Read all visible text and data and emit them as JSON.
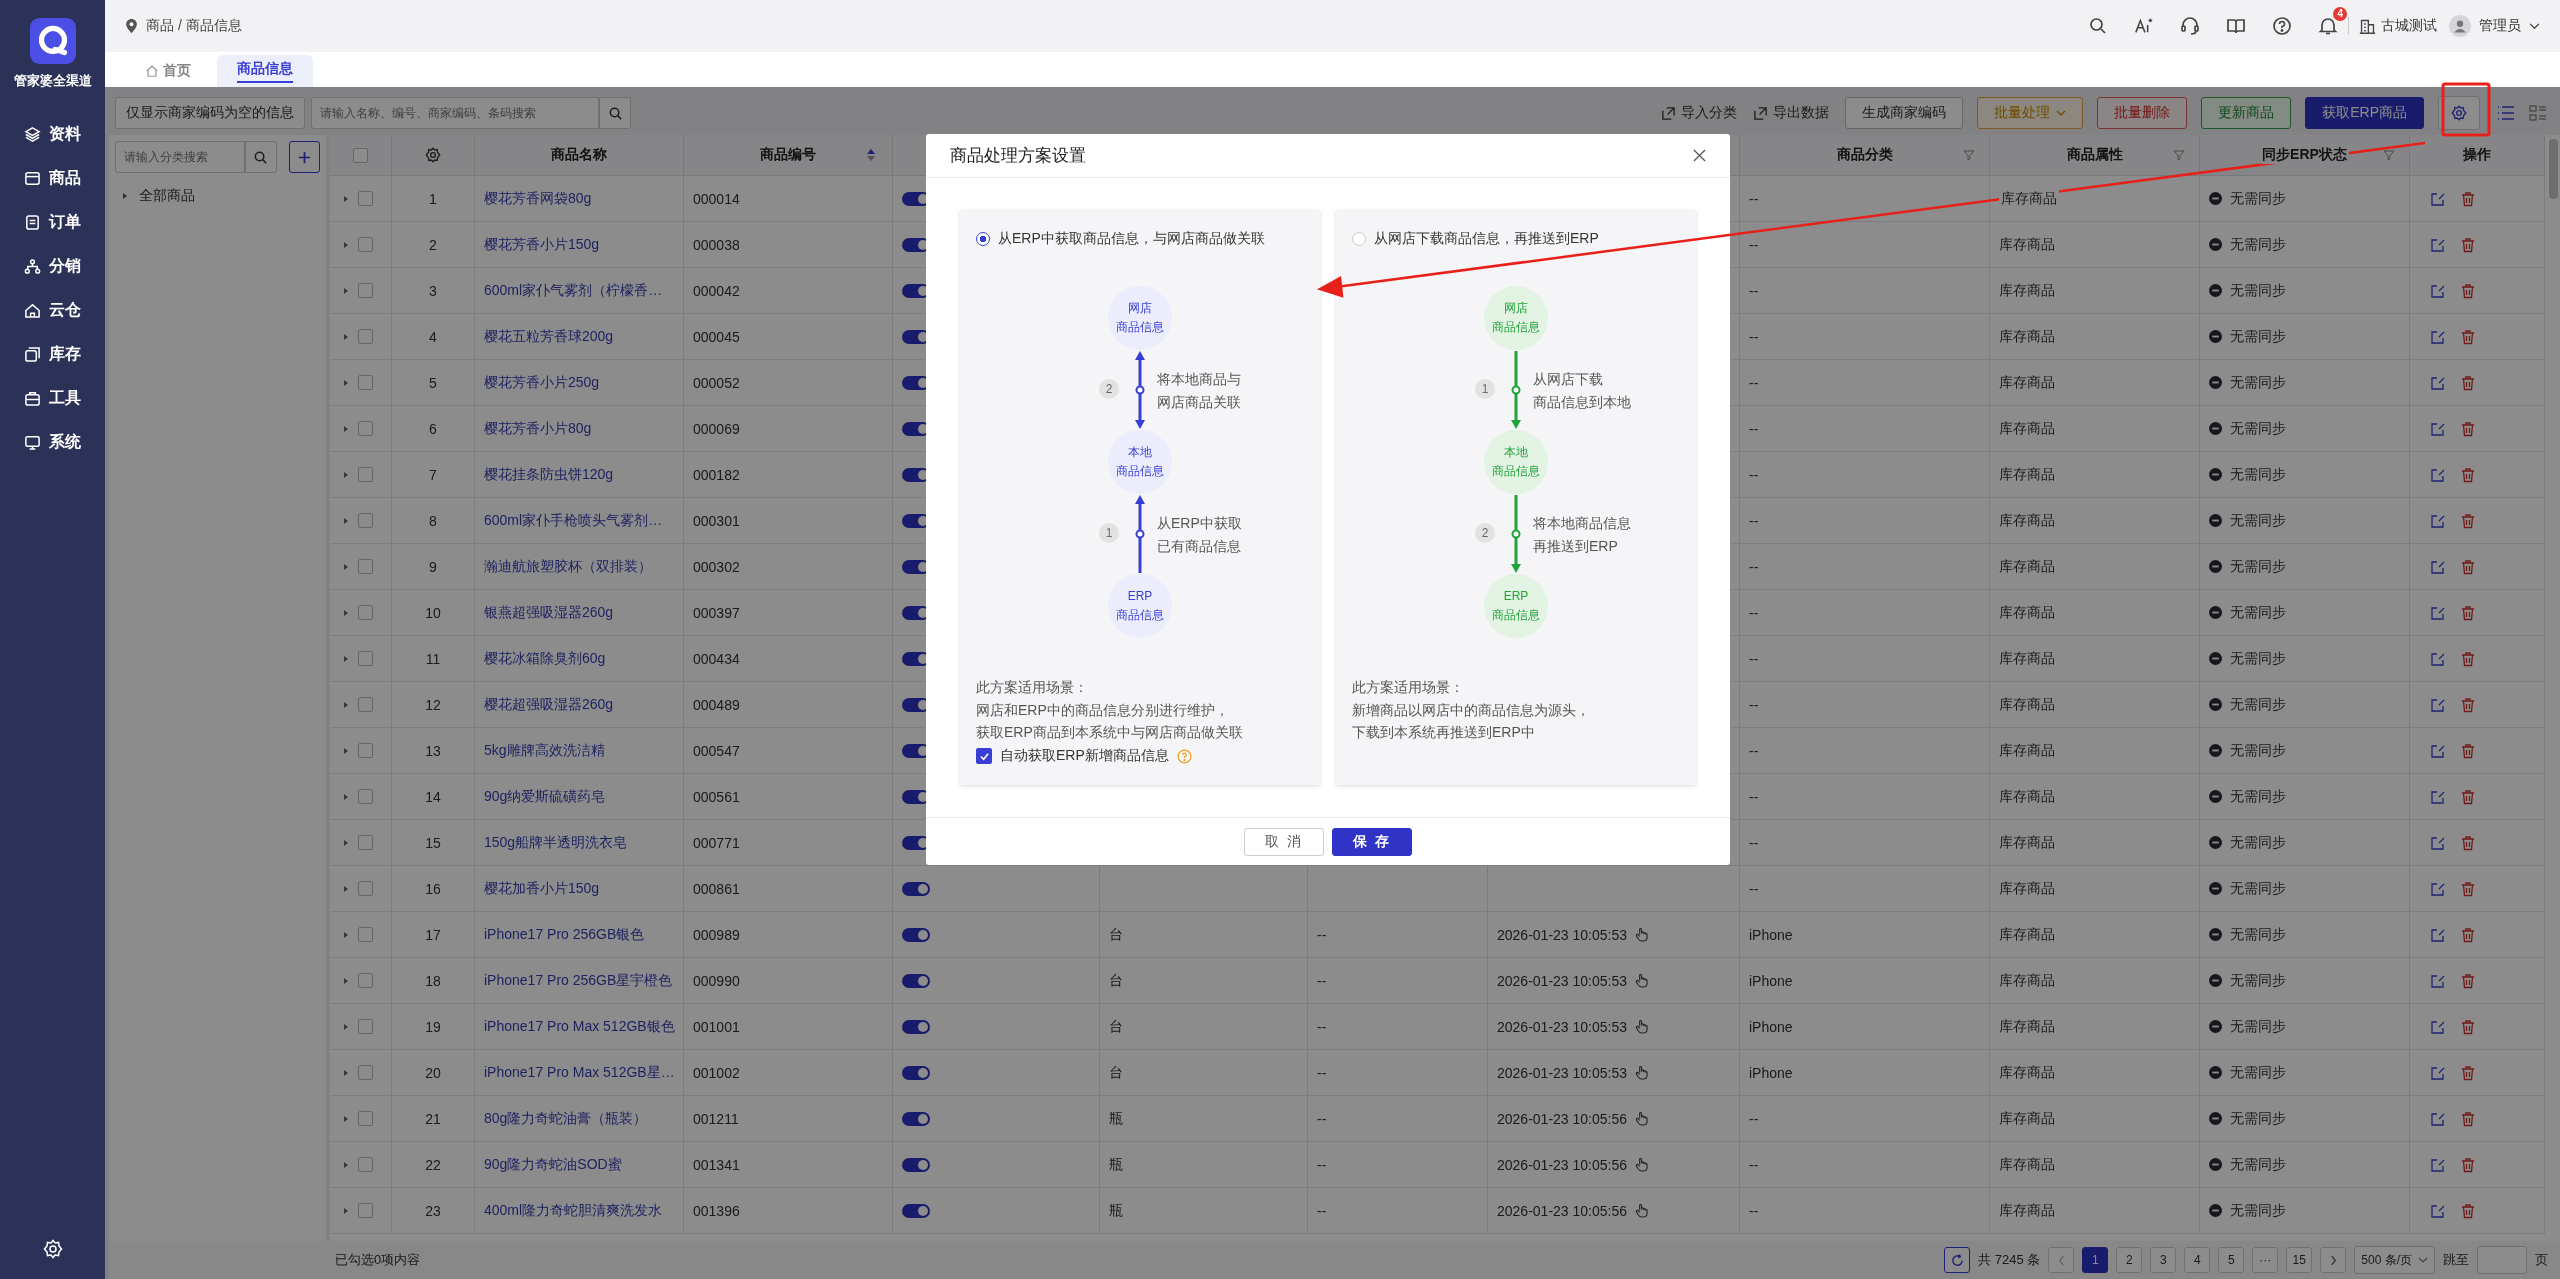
{
  "sidebar": {
    "brand": "管家婆全渠道",
    "items": [
      {
        "label": "资料"
      },
      {
        "label": "商品"
      },
      {
        "label": "订单"
      },
      {
        "label": "分销"
      },
      {
        "label": "云仓"
      },
      {
        "label": "库存"
      },
      {
        "label": "工具"
      },
      {
        "label": "系统"
      }
    ]
  },
  "header": {
    "breadcrumb": "商品 / 商品信息",
    "notification_count": "4",
    "company": "古城测试",
    "user": "管理员"
  },
  "tabs": [
    {
      "label": "首页",
      "selected": false
    },
    {
      "label": "商品信息",
      "selected": true
    }
  ],
  "toolbar": {
    "filter_button": "仅显示商家编码为空的信息",
    "search_placeholder": "请输入名称、编号、商家编码、条码搜索",
    "links": [
      "导入分类",
      "导出数据"
    ],
    "buttons": [
      {
        "label": "生成商家编码",
        "kind": "default"
      },
      {
        "label": "批量处理",
        "kind": "warning"
      },
      {
        "label": "批量删除",
        "kind": "danger"
      },
      {
        "label": "更新商品",
        "kind": "success"
      },
      {
        "label": "获取ERP商品",
        "kind": "primary"
      }
    ]
  },
  "category_panel": {
    "search_placeholder": "请输入分类搜索",
    "tree": [
      {
        "label": "全部商品",
        "expanded": false
      }
    ]
  },
  "table": {
    "header_checked": false,
    "columns": [
      {
        "label": "商品名称"
      },
      {
        "label": "商品编号",
        "sortable": true
      },
      {
        "label": "商品分类",
        "filterable": true
      },
      {
        "label": "商品属性",
        "filterable": true
      },
      {
        "label": "同步ERP状态",
        "filterable": true
      },
      {
        "label": "操作"
      }
    ],
    "rows": [
      {
        "index": "1",
        "name": "樱花芳香网袋80g",
        "code": "000014",
        "enabled": true,
        "checked": false,
        "category": "--",
        "attribute": "库存商品",
        "sync": "无需同步"
      },
      {
        "index": "2",
        "name": "樱花芳香小片150g",
        "code": "000038",
        "enabled": true,
        "checked": false,
        "category": "--",
        "attribute": "库存商品",
        "sync": "无需同步"
      },
      {
        "index": "3",
        "name": "600ml家仆气雾剂（柠檬香…",
        "code": "000042",
        "enabled": true,
        "checked": false,
        "category": "--",
        "attribute": "库存商品",
        "sync": "无需同步"
      },
      {
        "index": "4",
        "name": "樱花五粒芳香球200g",
        "code": "000045",
        "enabled": true,
        "checked": false,
        "category": "--",
        "attribute": "库存商品",
        "sync": "无需同步"
      },
      {
        "index": "5",
        "name": "樱花芳香小片250g",
        "code": "000052",
        "enabled": true,
        "checked": false,
        "category": "--",
        "attribute": "库存商品",
        "sync": "无需同步"
      },
      {
        "index": "6",
        "name": "樱花芳香小片80g",
        "code": "000069",
        "enabled": true,
        "checked": false,
        "category": "--",
        "attribute": "库存商品",
        "sync": "无需同步"
      },
      {
        "index": "7",
        "name": "樱花挂条防虫饼120g",
        "code": "000182",
        "enabled": true,
        "checked": false,
        "category": "--",
        "attribute": "库存商品",
        "sync": "无需同步"
      },
      {
        "index": "8",
        "name": "600ml家仆手枪喷头气雾剂…",
        "code": "000301",
        "enabled": true,
        "checked": false,
        "category": "--",
        "attribute": "库存商品",
        "sync": "无需同步"
      },
      {
        "index": "9",
        "name": "瀚迪航旅塑胶杯（双排装）",
        "code": "000302",
        "enabled": true,
        "checked": false,
        "category": "--",
        "attribute": "库存商品",
        "sync": "无需同步"
      },
      {
        "index": "10",
        "name": "银燕超强吸湿器260g",
        "code": "000397",
        "enabled": true,
        "checked": false,
        "category": "--",
        "attribute": "库存商品",
        "sync": "无需同步"
      },
      {
        "index": "11",
        "name": "樱花冰箱除臭剂60g",
        "code": "000434",
        "enabled": true,
        "checked": false,
        "category": "--",
        "attribute": "库存商品",
        "sync": "无需同步"
      },
      {
        "index": "12",
        "name": "樱花超强吸湿器260g",
        "code": "000489",
        "enabled": true,
        "checked": false,
        "category": "--",
        "attribute": "库存商品",
        "sync": "无需同步"
      },
      {
        "index": "13",
        "name": "5kg雕牌高效洗洁精",
        "code": "000547",
        "enabled": true,
        "checked": false,
        "category": "--",
        "attribute": "库存商品",
        "sync": "无需同步"
      },
      {
        "index": "14",
        "name": "90g纳爱斯硫磺药皂",
        "code": "000561",
        "enabled": true,
        "checked": false,
        "category": "--",
        "attribute": "库存商品",
        "sync": "无需同步"
      },
      {
        "index": "15",
        "name": "150g船牌半透明洗衣皂",
        "code": "000771",
        "enabled": true,
        "checked": false,
        "category": "--",
        "attribute": "库存商品",
        "sync": "无需同步"
      },
      {
        "index": "16",
        "name": "樱花加香小片150g",
        "code": "000861",
        "enabled": true,
        "checked": false,
        "category": "--",
        "attribute": "库存商品",
        "sync": "无需同步"
      },
      {
        "index": "17",
        "name": "iPhone17 Pro 256GB银色",
        "code": "000989",
        "enabled": true,
        "checked": false,
        "unit": "台",
        "column_7": "--",
        "time": "2026-01-23 10:05:53",
        "category": "iPhone",
        "attribute": "库存商品",
        "sync": "无需同步"
      },
      {
        "index": "18",
        "name": "iPhone17 Pro 256GB星宇橙色",
        "code": "000990",
        "enabled": true,
        "checked": false,
        "unit": "台",
        "column_7": "--",
        "time": "2026-01-23 10:05:53",
        "category": "iPhone",
        "attribute": "库存商品",
        "sync": "无需同步"
      },
      {
        "index": "19",
        "name": "iPhone17 Pro Max 512GB银色",
        "code": "001001",
        "enabled": true,
        "checked": false,
        "unit": "台",
        "column_7": "--",
        "time": "2026-01-23 10:05:53",
        "category": "iPhone",
        "attribute": "库存商品",
        "sync": "无需同步"
      },
      {
        "index": "20",
        "name": "iPhone17 Pro Max 512GB星…",
        "code": "001002",
        "enabled": true,
        "checked": false,
        "unit": "台",
        "column_7": "--",
        "time": "2026-01-23 10:05:53",
        "category": "iPhone",
        "attribute": "库存商品",
        "sync": "无需同步"
      },
      {
        "index": "21",
        "name": "80g隆力奇蛇油膏（瓶装）",
        "code": "001211",
        "enabled": true,
        "checked": false,
        "unit": "瓶",
        "column_7": "--",
        "time": "2026-01-23 10:05:56",
        "category": "--",
        "attribute": "库存商品",
        "sync": "无需同步"
      },
      {
        "index": "22",
        "name": "90g隆力奇蛇油SOD蜜",
        "code": "001341",
        "enabled": true,
        "checked": false,
        "unit": "瓶",
        "column_7": "--",
        "time": "2026-01-23 10:05:56",
        "category": "--",
        "attribute": "库存商品",
        "sync": "无需同步"
      },
      {
        "index": "23",
        "name": "400ml隆力奇蛇胆清爽洗发水",
        "code": "001396",
        "enabled": true,
        "checked": false,
        "unit": "瓶",
        "column_7": "--",
        "time": "2026-01-23 10:05:56",
        "category": "--",
        "attribute": "库存商品",
        "sync": "无需同步"
      }
    ]
  },
  "footer": {
    "selection": "已勾选0项内容",
    "total": "共 7245 条",
    "pages": [
      {
        "label": "1",
        "selected": true
      },
      {
        "label": "2",
        "selected": false
      },
      {
        "label": "3",
        "selected": false
      },
      {
        "label": "4",
        "selected": false
      },
      {
        "label": "5",
        "selected": false
      },
      {
        "label": "···",
        "selected": false
      },
      {
        "label": "15",
        "selected": false
      }
    ],
    "page_size": "500 条/页",
    "jump_label": "跳至",
    "page_unit": "页"
  },
  "dialog": {
    "title": "商品处理方案设置",
    "cancel": "取 消",
    "save": "保 存",
    "options": [
      {
        "label": "从ERP中获取商品信息，与网店商品做关联",
        "selected": true,
        "color": "#3a3fd4",
        "nodes": [
          [
            "网店",
            "商品信息"
          ],
          [
            "本地",
            "商品信息"
          ],
          [
            "ERP",
            "商品信息"
          ]
        ],
        "steps": [
          {
            "number": "2",
            "lines": [
              "将本地商品与",
              "网店商品关联"
            ],
            "kind": "both"
          },
          {
            "number": "1",
            "lines": [
              "从ERP中获取",
              "已有商品信息"
            ],
            "kind": "up"
          }
        ],
        "scenario": [
          "此方案适用场景：",
          "网店和ERP中的商品信息分别进行维护，",
          "获取ERP商品到本系统中与网店商品做关联"
        ],
        "auto_fetch": {
          "label": "自动获取ERP新增商品信息",
          "checked": true
        }
      },
      {
        "label": "从网店下载商品信息，再推送到ERP",
        "selected": false,
        "color": "#22a33a",
        "nodes": [
          [
            "网店",
            "商品信息"
          ],
          [
            "本地",
            "商品信息"
          ],
          [
            "ERP",
            "商品信息"
          ]
        ],
        "steps": [
          {
            "number": "1",
            "lines": [
              "从网店下载",
              "商品信息到本地"
            ],
            "kind": "down"
          },
          {
            "number": "2",
            "lines": [
              "将本地商品信息",
              "再推送到ERP"
            ],
            "kind": "down"
          }
        ],
        "scenario": [
          "此方案适用场景：",
          "新增商品以网店中的商品信息为源头，",
          "下载到本系统再推送到ERP中"
        ]
      }
    ]
  }
}
